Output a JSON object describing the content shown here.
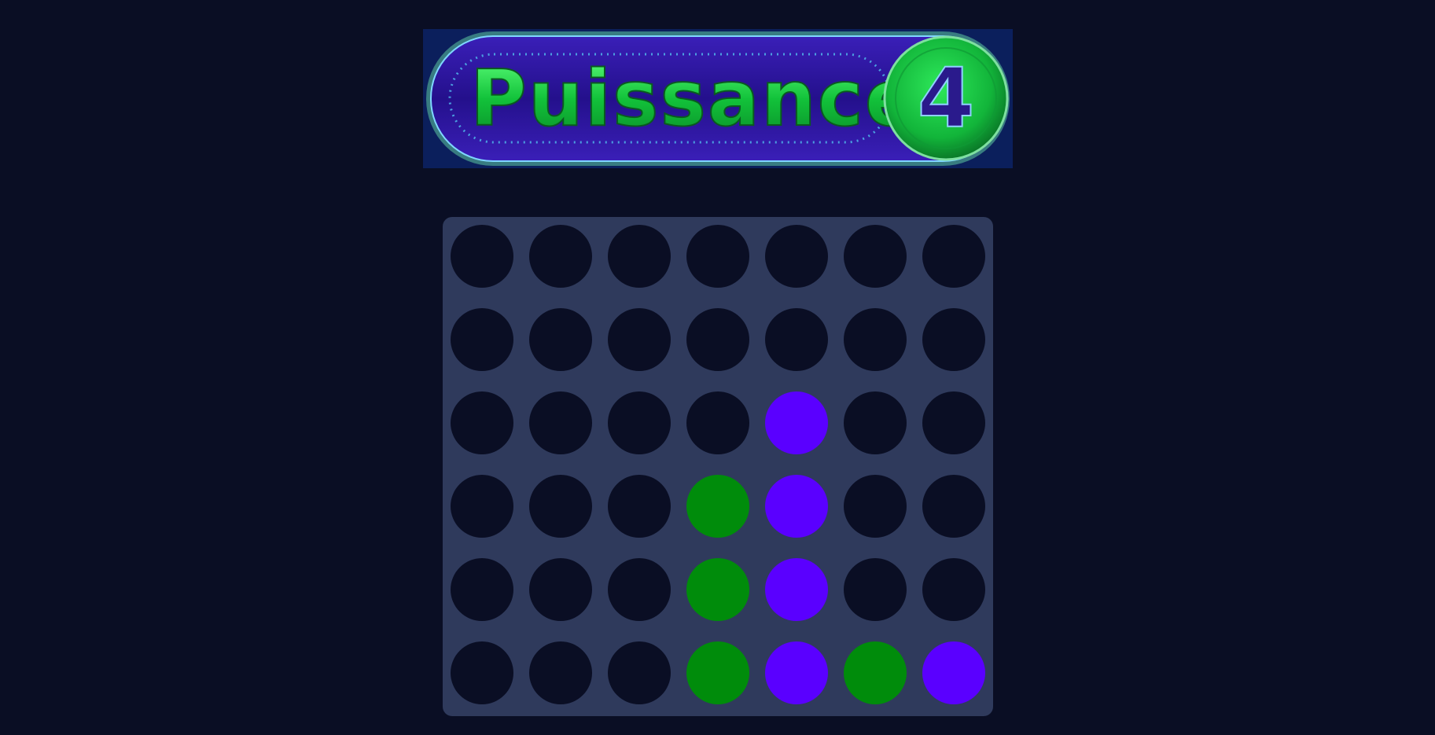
{
  "logo": {
    "text": "Puissance",
    "number": "4"
  },
  "colors": {
    "background": "#0a0e24",
    "board": "#2f3a5c",
    "empty": "#0a0e24",
    "player_green": "#008c0b",
    "player_purple": "#5a00ff"
  },
  "board": {
    "columns": 7,
    "rows": 6,
    "cells": [
      [
        "empty",
        "empty",
        "empty",
        "empty",
        "empty",
        "empty",
        "empty"
      ],
      [
        "empty",
        "empty",
        "empty",
        "empty",
        "empty",
        "empty",
        "empty"
      ],
      [
        "empty",
        "empty",
        "empty",
        "empty",
        "purple",
        "empty",
        "empty"
      ],
      [
        "empty",
        "empty",
        "empty",
        "green",
        "purple",
        "empty",
        "empty"
      ],
      [
        "empty",
        "empty",
        "empty",
        "green",
        "purple",
        "empty",
        "empty"
      ],
      [
        "empty",
        "empty",
        "empty",
        "green",
        "purple",
        "green",
        "purple"
      ]
    ]
  }
}
